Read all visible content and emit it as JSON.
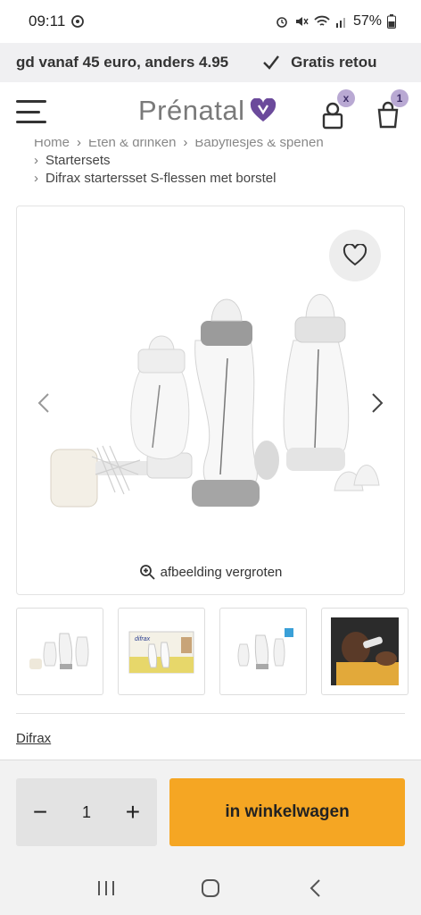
{
  "status_bar": {
    "time": "09:11",
    "battery": "57%",
    "icons": [
      "alarm-icon",
      "mute-icon",
      "wifi-icon",
      "signal-icon",
      "battery-icon"
    ]
  },
  "promo": {
    "left_text": "gd vanaf 45 euro, anders 4.95",
    "right_text": "Gratis retou"
  },
  "header": {
    "logo_text": "Prénatal",
    "account_badge": "x",
    "cart_badge": "1",
    "accent_color": "#6b4a9b"
  },
  "breadcrumb": {
    "top_row": [
      "Home",
      "Eten & drinken",
      "Babyflesjes & spenen"
    ],
    "items": [
      "Startersets",
      "Difrax startersset S-flessen met borstel"
    ]
  },
  "gallery": {
    "zoom_label": "afbeelding vergroten",
    "thumbnails": [
      "bottle-set-thumbnail",
      "packaging-thumbnail",
      "bottle-set-info-thumbnail",
      "baby-feeding-thumbnail"
    ]
  },
  "brand": {
    "name": "Difrax"
  },
  "cart_bar": {
    "quantity": "1",
    "minus": "−",
    "plus": "+",
    "add_label": "in winkelwagen",
    "button_color": "#f5a623"
  }
}
